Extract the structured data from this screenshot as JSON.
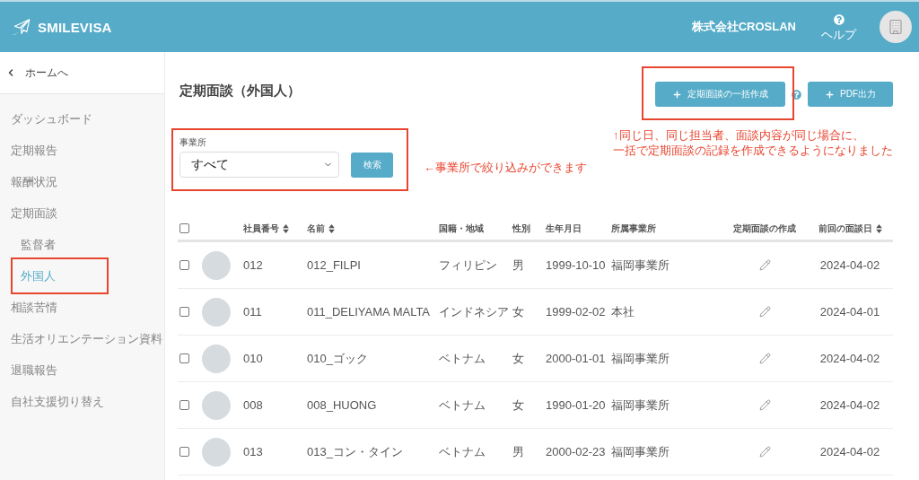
{
  "header": {
    "logo_text": "SMILEVISA",
    "company": "株式会社CROSLAN",
    "help_label": "ヘルプ"
  },
  "sidebar": {
    "back_link": "ホームへ",
    "items": [
      {
        "label": "ダッシュボード",
        "selected": false,
        "highlighted": false
      },
      {
        "label": "定期報告",
        "selected": false,
        "highlighted": false
      },
      {
        "label": "報酬状況",
        "selected": false,
        "highlighted": false
      },
      {
        "label": "定期面談",
        "selected": false,
        "highlighted": false,
        "children": [
          {
            "label": "監督者",
            "selected": false,
            "highlighted": false
          },
          {
            "label": "外国人",
            "selected": true,
            "highlighted": true
          }
        ]
      },
      {
        "label": "相談苦情",
        "selected": false,
        "highlighted": false
      },
      {
        "label": "生活オリエンテーション資料",
        "selected": false,
        "highlighted": false
      },
      {
        "label": "退職報告",
        "selected": false,
        "highlighted": false
      },
      {
        "label": "自社支援切り替え",
        "selected": false,
        "highlighted": false
      }
    ]
  },
  "page": {
    "title": "定期面談（外国人）",
    "actions": [
      {
        "label": "定期面談の一括作成",
        "highlighted": true,
        "help": true
      },
      {
        "label": "PDF出力",
        "highlighted": false,
        "help": false
      }
    ]
  },
  "filter": {
    "label": "事業所",
    "value": "すべて",
    "button": "検索",
    "highlighted": true
  },
  "annotations": [
    {
      "kind": "side",
      "lines": [
        "←事業所で絞り込みができます"
      ]
    },
    {
      "kind": "top",
      "lines": [
        "↑同じ日、同じ担当者、面談内容が同じ場合に、",
        "一括で定期面談の記録を作成できるようになりました"
      ]
    }
  ],
  "table": {
    "select_all": {
      "checked": false
    },
    "columns": [
      {
        "label": "社員番号",
        "sortable": true
      },
      {
        "label": "名前",
        "sortable": true
      },
      {
        "label": "国籍・地域",
        "sortable": false
      },
      {
        "label": "性別",
        "sortable": false
      },
      {
        "label": "生年月日",
        "sortable": false
      },
      {
        "label": "所属事業所",
        "sortable": false
      },
      {
        "label": "定期面談の作成",
        "sortable": false
      },
      {
        "label": "前回の面談日",
        "sortable": true
      }
    ],
    "rows": [
      {
        "checked": false,
        "employee_no": "012",
        "name": "012_FILPI",
        "nationality": "フィリピン",
        "gender": "男",
        "birth_date": "1999-10-10",
        "office": "福岡事業所",
        "last_interview": "2024-04-02"
      },
      {
        "checked": false,
        "employee_no": "011",
        "name": "011_DELIYAMA MALTA",
        "nationality": "インドネシア",
        "gender": "女",
        "birth_date": "1999-02-02",
        "office": "本社",
        "last_interview": "2024-04-01"
      },
      {
        "checked": false,
        "employee_no": "010",
        "name": "010_ゴック",
        "nationality": "ベトナム",
        "gender": "女",
        "birth_date": "2000-01-01",
        "office": "福岡事業所",
        "last_interview": "2024-04-02"
      },
      {
        "checked": false,
        "employee_no": "008",
        "name": "008_HUONG",
        "nationality": "ベトナム",
        "gender": "女",
        "birth_date": "1990-01-20",
        "office": "福岡事業所",
        "last_interview": "2024-04-02"
      },
      {
        "checked": false,
        "employee_no": "013",
        "name": "013_コン・タイン",
        "nationality": "ベトナム",
        "gender": "男",
        "birth_date": "2000-02-23",
        "office": "福岡事業所",
        "last_interview": "2024-04-02"
      }
    ]
  }
}
